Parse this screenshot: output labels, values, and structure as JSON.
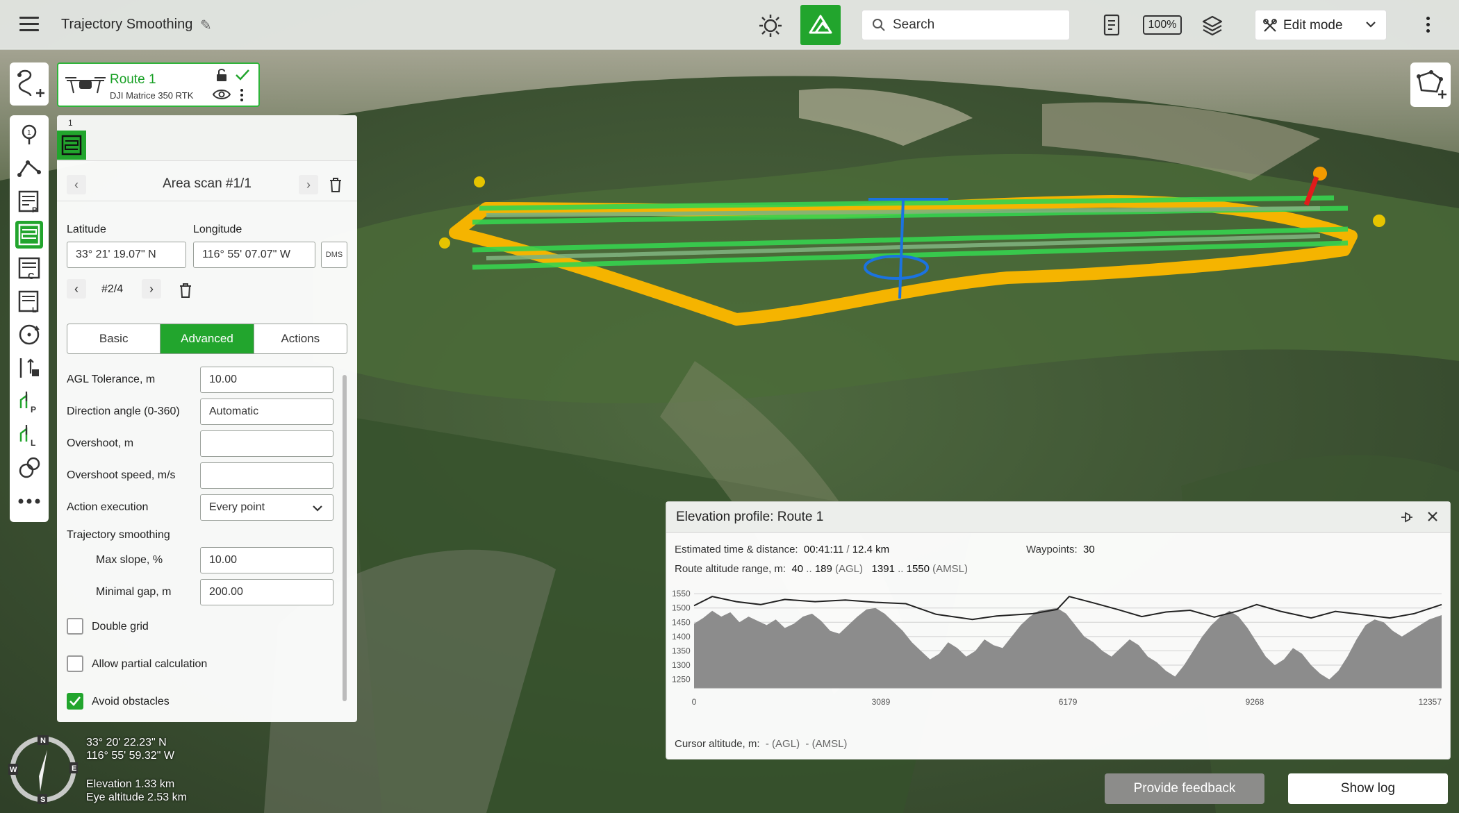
{
  "topbar": {
    "title": "Trajectory Smoothing",
    "search_placeholder": "Search",
    "zoom": "100%",
    "edit_mode": "Edit mode"
  },
  "route": {
    "name": "Route 1",
    "model": "DJI Matrice 350 RTK"
  },
  "panel": {
    "segment_number": "1",
    "scan_title": "Area scan #1/1",
    "latitude_label": "Latitude",
    "longitude_label": "Longitude",
    "latitude": "33° 21' 19.07\" N",
    "longitude": "116° 55' 07.07\" W",
    "dms": "DMS",
    "point_index": "#2/4",
    "tabs": [
      "Basic",
      "Advanced",
      "Actions"
    ],
    "fields": {
      "agl_tolerance_label": "AGL Tolerance, m",
      "agl_tolerance": "10.00",
      "direction_label": "Direction angle (0-360)",
      "direction": "Automatic",
      "overshoot_label": "Overshoot, m",
      "overshoot": "",
      "overshoot_speed_label": "Overshoot speed, m/s",
      "overshoot_speed": "",
      "action_exec_label": "Action execution",
      "action_exec": "Every point",
      "smoothing_label": "Trajectory smoothing",
      "max_slope_label": "Max slope, %",
      "max_slope": "10.00",
      "min_gap_label": "Minimal gap, m",
      "min_gap": "200.00"
    },
    "checks": {
      "double_grid": "Double grid",
      "partial_calc": "Allow partial calculation",
      "avoid_obstacles": "Avoid obstacles"
    }
  },
  "map_info": {
    "lat": "33° 20' 22.23\" N",
    "lon": "116° 55' 59.32\" W",
    "elevation": "Elevation 1.33 km",
    "eye_altitude": "Eye altitude 2.53 km",
    "compass": {
      "n": "N",
      "e": "E",
      "s": "S",
      "w": "W"
    }
  },
  "elevation": {
    "title": "Elevation profile: Route 1",
    "est_label": "Estimated time & distance:",
    "est_time": "00:41:11",
    "slash": "/",
    "est_dist": "12.4 km",
    "waypoints_label": "Waypoints:",
    "waypoints": "30",
    "range_label": "Route altitude range, m:",
    "agl_min": "40",
    "dots": "..",
    "agl_max": "189",
    "agl_tag": "(AGL)",
    "amsl_min": "1391",
    "amsl_max": "1550",
    "amsl_tag": "(AMSL)",
    "cursor_label": "Cursor altitude, m:",
    "cursor_agl": "- (AGL)",
    "cursor_amsl": "- (AMSL)"
  },
  "chart_data": {
    "type": "area",
    "x_ticks": [
      "0",
      "3089",
      "6179",
      "9268",
      "12357"
    ],
    "y_ticks": [
      "1550",
      "1500",
      "1450",
      "1400",
      "1350",
      "1300",
      "1250"
    ],
    "xlim": [
      0,
      12357
    ],
    "ylim": [
      1220,
      1560
    ],
    "series": [
      {
        "type": "line",
        "x": [
          0,
          300,
          700,
          1100,
          1500,
          2000,
          2500,
          3000,
          3500,
          4000,
          4600,
          5000,
          5600,
          6000,
          6200,
          6600,
          7000,
          7400,
          7800,
          8200,
          8600,
          9000,
          9300,
          9700,
          10200,
          10600,
          11000,
          11500,
          11900,
          12357
        ],
        "y": [
          1508,
          1540,
          1522,
          1512,
          1530,
          1522,
          1528,
          1520,
          1515,
          1478,
          1460,
          1472,
          1480,
          1495,
          1540,
          1518,
          1495,
          1470,
          1486,
          1492,
          1468,
          1490,
          1512,
          1488,
          1465,
          1488,
          1478,
          1465,
          1480,
          1512
        ]
      },
      {
        "type": "area",
        "x": [
          0,
          150,
          300,
          450,
          600,
          750,
          900,
          1050,
          1200,
          1350,
          1500,
          1650,
          1800,
          1950,
          2100,
          2250,
          2400,
          2550,
          2700,
          2850,
          3000,
          3150,
          3300,
          3450,
          3600,
          3750,
          3900,
          4050,
          4200,
          4350,
          4500,
          4650,
          4800,
          4950,
          5100,
          5250,
          5400,
          5550,
          5700,
          5850,
          6000,
          6150,
          6300,
          6450,
          6600,
          6750,
          6900,
          7050,
          7200,
          7350,
          7500,
          7650,
          7800,
          7950,
          8100,
          8250,
          8400,
          8550,
          8700,
          8850,
          9000,
          9150,
          9300,
          9450,
          9600,
          9750,
          9900,
          10050,
          10200,
          10350,
          10500,
          10650,
          10800,
          10950,
          11100,
          11250,
          11400,
          11550,
          11700,
          11850,
          12000,
          12150,
          12357
        ],
        "y": [
          1445,
          1465,
          1490,
          1470,
          1485,
          1450,
          1470,
          1455,
          1440,
          1460,
          1430,
          1445,
          1470,
          1480,
          1455,
          1420,
          1410,
          1440,
          1470,
          1495,
          1500,
          1480,
          1450,
          1420,
          1380,
          1350,
          1320,
          1340,
          1380,
          1360,
          1330,
          1350,
          1390,
          1370,
          1360,
          1400,
          1440,
          1470,
          1490,
          1495,
          1500,
          1480,
          1440,
          1400,
          1380,
          1350,
          1330,
          1360,
          1390,
          1370,
          1330,
          1310,
          1280,
          1260,
          1300,
          1350,
          1400,
          1440,
          1470,
          1490,
          1470,
          1430,
          1380,
          1330,
          1300,
          1320,
          1360,
          1340,
          1300,
          1270,
          1250,
          1280,
          1330,
          1390,
          1440,
          1460,
          1450,
          1420,
          1400,
          1420,
          1440,
          1460,
          1475
        ]
      }
    ],
    "grid": true
  }
}
